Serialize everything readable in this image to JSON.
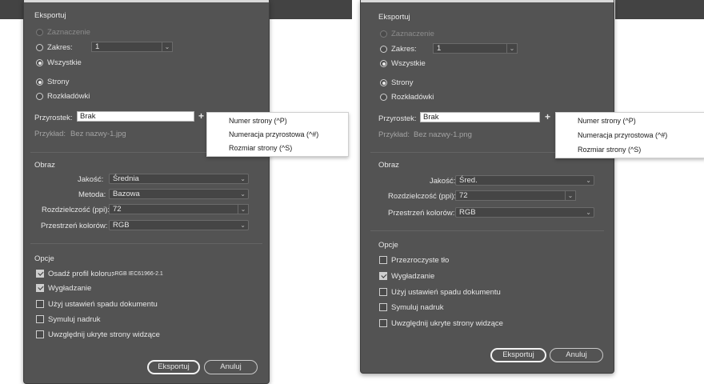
{
  "left": {
    "export_title": "Eksportuj",
    "selection": "Zaznaczenie",
    "range_label": "Zakres:",
    "range_value": "1",
    "all": "Wszystkie",
    "pages": "Strony",
    "spreads": "Rozkładówki",
    "suffix_label": "Przyrostek:",
    "suffix_value": "Brak",
    "example_label": "Przykład:",
    "example_value": "Bez nazwy-1.jpg",
    "menu": [
      "Numer strony (^P)",
      "Numeracja przyrostowa (^#)",
      "Rozmiar strony (^S)"
    ],
    "image_title": "Obraz",
    "quality_label": "Jakość:",
    "quality_value": "Średnia",
    "method_label": "Metoda:",
    "method_value": "Bazowa",
    "resolution_label": "Rozdzielczość (ppi):",
    "resolution_value": "72",
    "color_space_label": "Przestrzeń kolorów:",
    "color_space_value": "RGB",
    "options_title": "Opcje",
    "embed_profile": "Osadź profil koloru:",
    "embed_profile_value": "sRGB IEC61966-2.1",
    "antialias": "Wygładzanie",
    "bleed": "Użyj ustawień spadu dokumentu",
    "overprint": "Symuluj nadruk",
    "hidden_pages": "Uwzględnij ukryte strony widzące",
    "export_button": "Eksportuj",
    "cancel_button": "Anuluj"
  },
  "right": {
    "export_title": "Eksportuj",
    "selection": "Zaznaczenie",
    "range_label": "Zakres:",
    "range_value": "1",
    "all": "Wszystkie",
    "pages": "Strony",
    "spreads": "Rozkładówki",
    "suffix_label": "Przyrostek:",
    "suffix_value": "Brak",
    "example_label": "Przykład:",
    "example_value": "Bez nazwy-1.png",
    "menu": [
      "Numer strony (^P)",
      "Numeracja przyrostowa (^#)",
      "Rozmiar strony (^S)"
    ],
    "image_title": "Obraz",
    "quality_label": "Jakość:",
    "quality_value": "Śred.",
    "resolution_label": "Rozdzielczość (ppi):",
    "resolution_value": "72",
    "color_space_label": "Przestrzeń kolorów:",
    "color_space_value": "RGB",
    "options_title": "Opcje",
    "transparent": "Przezroczyste tło",
    "antialias": "Wygładzanie",
    "bleed": "Użyj ustawień spadu dokumentu",
    "overprint": "Symuluj nadruk",
    "hidden_pages": "Uwzględnij ukryte strony widzące",
    "export_button": "Eksportuj",
    "cancel_button": "Anuluj"
  },
  "icons": {
    "chevron": "chevron-down-icon",
    "plus": "plus-icon"
  },
  "colors": {
    "dialog_bg": "#535353",
    "topbar_bg": "#434343",
    "menu_bg": "#ffffff"
  }
}
